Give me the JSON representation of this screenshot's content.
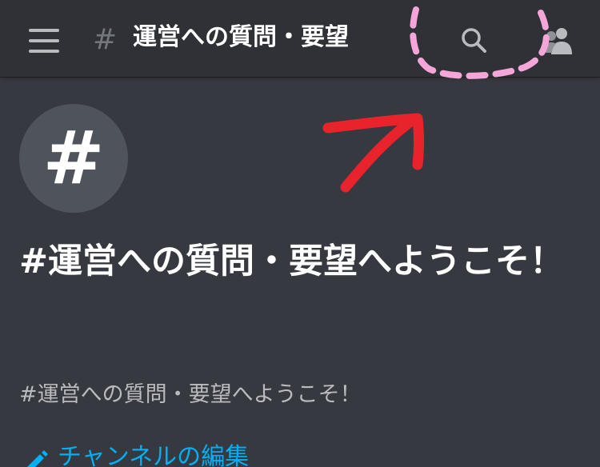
{
  "header": {
    "menu_icon": "hamburger-menu-icon",
    "channel_prefix": "#",
    "channel_name": "運営への質問・要望",
    "search_icon": "search-icon",
    "members_icon": "members-icon"
  },
  "welcome": {
    "avatar_glyph": "#",
    "heading": "#運営への質問・要望へようこそ！",
    "subtitle": "#運営への質問・要望へようこそ！"
  },
  "actions": {
    "edit_channel_label": "チャンネルの編集",
    "edit_icon": "pencil-icon"
  },
  "annotations": {
    "highlight_color": "#f5a6d8",
    "arrow_color": "#e8232c"
  },
  "colors": {
    "background": "#36393f",
    "topbar": "#2f3136",
    "link": "#00aff4"
  }
}
